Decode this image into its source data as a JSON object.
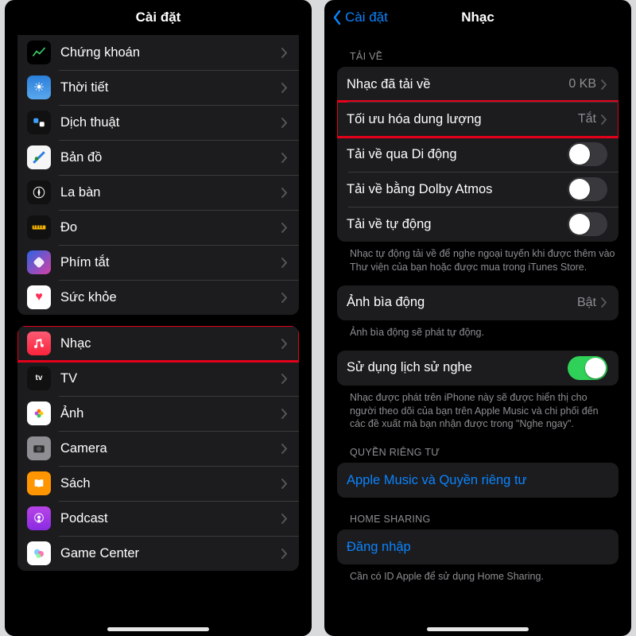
{
  "left": {
    "title": "Cài đặt",
    "group1": [
      {
        "key": "stocks",
        "label": "Chứng khoán"
      },
      {
        "key": "weather",
        "label": "Thời tiết"
      },
      {
        "key": "translate",
        "label": "Dịch thuật"
      },
      {
        "key": "maps",
        "label": "Bản đồ"
      },
      {
        "key": "compass",
        "label": "La bàn"
      },
      {
        "key": "measure",
        "label": "Đo"
      },
      {
        "key": "shortcuts",
        "label": "Phím tắt"
      },
      {
        "key": "health",
        "label": "Sức khỏe"
      }
    ],
    "group2": [
      {
        "key": "music",
        "label": "Nhạc",
        "highlight": true
      },
      {
        "key": "tv",
        "label": "TV"
      },
      {
        "key": "photos",
        "label": "Ảnh"
      },
      {
        "key": "camera",
        "label": "Camera"
      },
      {
        "key": "books",
        "label": "Sách"
      },
      {
        "key": "podcast",
        "label": "Podcast"
      },
      {
        "key": "gamecenter",
        "label": "Game Center"
      }
    ]
  },
  "right": {
    "back": "Cài đặt",
    "title": "Nhạc",
    "sections": {
      "downloads": {
        "header": "TẢI VỀ",
        "downloaded": {
          "label": "Nhạc đã tải về",
          "value": "0 KB"
        },
        "optimize": {
          "label": "Tối ưu hóa dung lượng",
          "value": "Tắt",
          "highlight": true
        },
        "cellular": {
          "label": "Tải về qua Di động",
          "on": false
        },
        "dolby": {
          "label": "Tải về bằng Dolby Atmos",
          "on": false
        },
        "auto": {
          "label": "Tải về tự động",
          "on": false
        },
        "footer": "Nhạc tự động tải về để nghe ngoại tuyến khi được thêm vào Thư viện của bạn hoặc được mua trong iTunes Store."
      },
      "animated": {
        "row": {
          "label": "Ảnh bìa động",
          "value": "Bật"
        },
        "footer": "Ảnh bìa động sẽ phát tự động."
      },
      "history": {
        "row": {
          "label": "Sử dụng lịch sử nghe",
          "on": true
        },
        "footer": "Nhạc được phát trên iPhone này sẽ được hiển thị cho người theo dõi của bạn trên Apple Music và chi phối đến các đề xuất mà bạn nhận được trong \"Nghe ngay\"."
      },
      "privacy": {
        "header": "QUYỀN RIÊNG TƯ",
        "row": {
          "label": "Apple Music và Quyền riêng tư"
        }
      },
      "homesharing": {
        "header": "HOME SHARING",
        "row": {
          "label": "Đăng nhập"
        },
        "footer": "Cần có ID Apple để sử dụng Home Sharing."
      }
    }
  }
}
